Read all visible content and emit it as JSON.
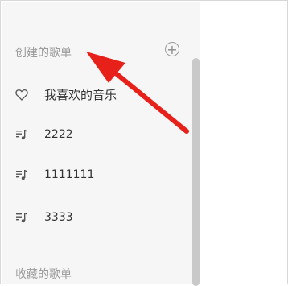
{
  "sidebar": {
    "created_section": {
      "title": "创建的歌单",
      "add_icon": "plus-circle-icon",
      "items": [
        {
          "label": "我喜欢的音乐",
          "icon": "heart-icon"
        },
        {
          "label": "2222",
          "icon": "playlist-icon"
        },
        {
          "label": "1111111",
          "icon": "playlist-icon"
        },
        {
          "label": "3333",
          "icon": "playlist-icon"
        }
      ]
    },
    "collected_section": {
      "title": "收藏的歌单"
    }
  },
  "annotation": {
    "color": "#e8201a",
    "icon": "red-arrow-annotation"
  }
}
